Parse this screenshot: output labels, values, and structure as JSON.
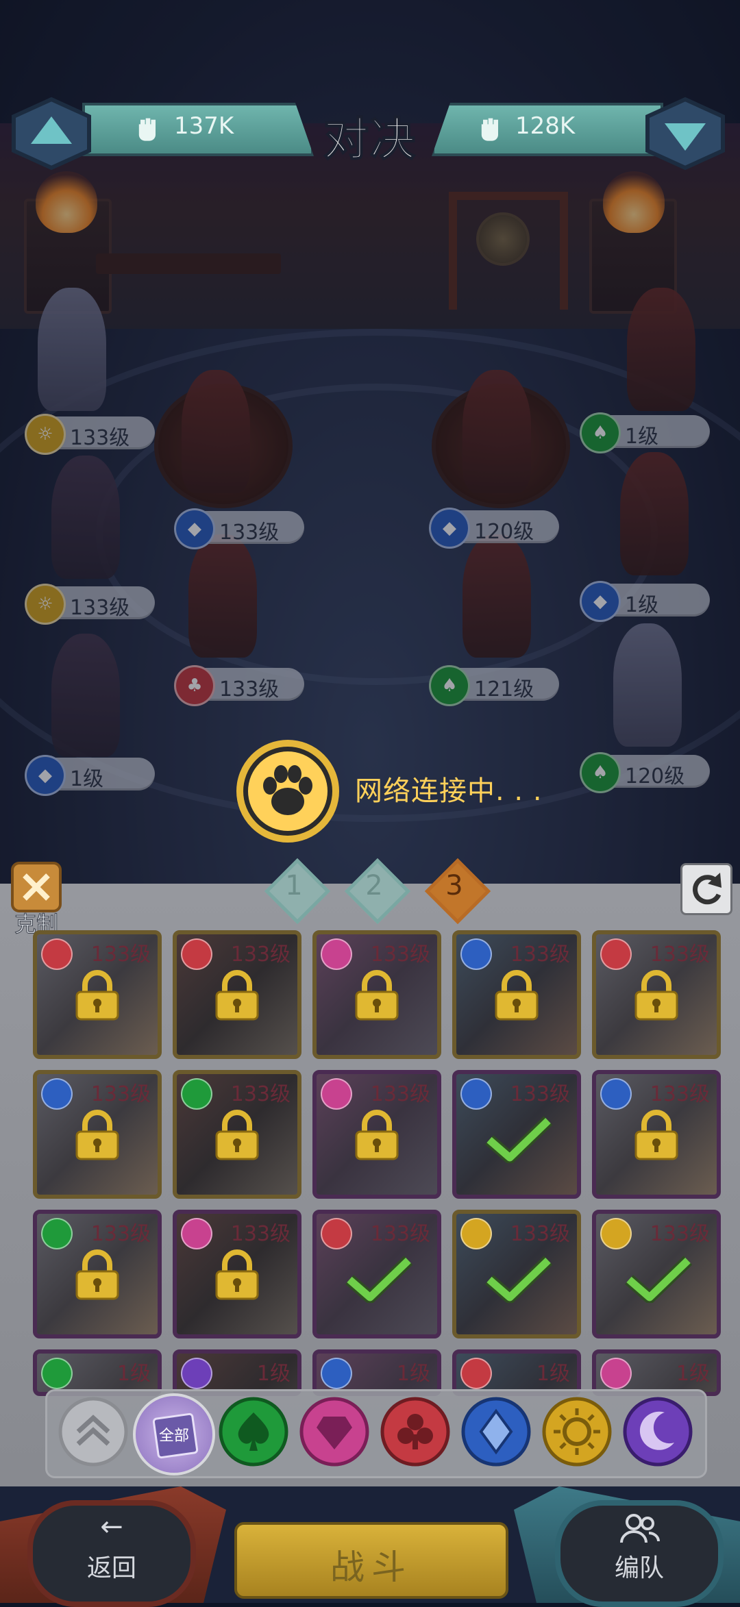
{
  "header": {
    "title": "对决",
    "left_power": "137K",
    "right_power": "128K"
  },
  "heroes_left": [
    {
      "level": "133级",
      "element": "sun"
    },
    {
      "level": "133级",
      "element": "sun"
    },
    {
      "level": "1级",
      "element": "diamond"
    },
    {
      "level": "133级",
      "element": "diamond"
    },
    {
      "level": "133级",
      "element": "club"
    }
  ],
  "heroes_right": [
    {
      "level": "1级",
      "element": "spade"
    },
    {
      "level": "1级",
      "element": "diamond"
    },
    {
      "level": "120级",
      "element": "spade"
    },
    {
      "level": "120级",
      "element": "diamond"
    },
    {
      "level": "121级",
      "element": "spade"
    }
  ],
  "loading": {
    "text": "网络连接中. . ."
  },
  "tabs": [
    "1",
    "2",
    "3"
  ],
  "active_tab": "3",
  "counter_label": "克制",
  "cards": [
    {
      "level": "133级",
      "element": "club",
      "state": "locked",
      "frame": "gold"
    },
    {
      "level": "133级",
      "element": "club",
      "state": "locked",
      "frame": "gold"
    },
    {
      "level": "133级",
      "element": "heart",
      "state": "locked",
      "frame": "gold"
    },
    {
      "level": "133级",
      "element": "diamond",
      "state": "locked",
      "frame": "gold"
    },
    {
      "level": "133级",
      "element": "club",
      "state": "locked",
      "frame": "gold"
    },
    {
      "level": "133级",
      "element": "diamond",
      "state": "locked",
      "frame": "gold"
    },
    {
      "level": "133级",
      "element": "spade",
      "state": "locked",
      "frame": "gold"
    },
    {
      "level": "133级",
      "element": "heart",
      "state": "locked",
      "frame": "purple"
    },
    {
      "level": "133级",
      "element": "diamond",
      "state": "selected",
      "frame": "purple"
    },
    {
      "level": "133级",
      "element": "diamond",
      "state": "locked",
      "frame": "purple"
    },
    {
      "level": "133级",
      "element": "spade",
      "state": "locked",
      "frame": "purple"
    },
    {
      "level": "133级",
      "element": "heart",
      "state": "locked",
      "frame": "purple"
    },
    {
      "level": "133级",
      "element": "club",
      "state": "selected",
      "frame": "purple"
    },
    {
      "level": "133级",
      "element": "sun",
      "state": "selected",
      "frame": "gold"
    },
    {
      "level": "133级",
      "element": "sun",
      "state": "selected",
      "frame": "purple"
    },
    {
      "level": "1级",
      "element": "spade",
      "state": "none",
      "frame": "purple"
    },
    {
      "level": "1级",
      "element": "moon",
      "state": "none",
      "frame": "purple"
    },
    {
      "level": "1级",
      "element": "diamond",
      "state": "none",
      "frame": "purple"
    },
    {
      "level": "1级",
      "element": "club",
      "state": "none",
      "frame": "purple"
    },
    {
      "level": "1级",
      "element": "heart",
      "state": "none",
      "frame": "purple"
    }
  ],
  "filters": {
    "all_label": "全部",
    "items": [
      "collapse",
      "all",
      "spade",
      "heart",
      "club",
      "diamond",
      "sun",
      "moon"
    ]
  },
  "actions": {
    "back_label": "返回",
    "fight_label": "战斗",
    "team_label": "编队"
  },
  "colors": {
    "spade": "#1f9a3a",
    "heart": "#c8428f",
    "club": "#c43a42",
    "diamond": "#2d5fc0",
    "sun": "#d4a521",
    "moon": "#6d3fb8",
    "accent_gold": "#ffd15a"
  }
}
